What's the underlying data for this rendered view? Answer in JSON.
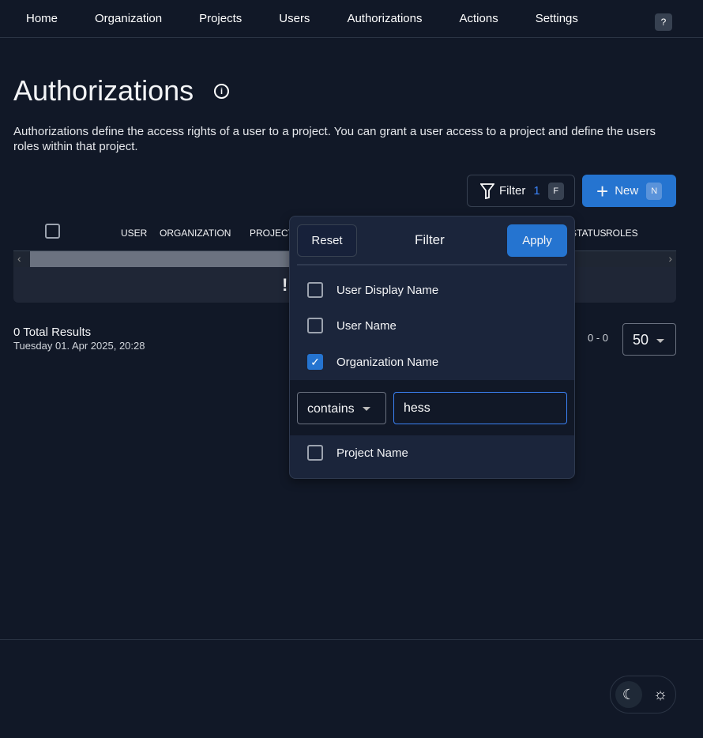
{
  "nav": {
    "items": [
      "Home",
      "Organization",
      "Projects",
      "Users",
      "Authorizations",
      "Actions",
      "Settings"
    ],
    "help": "?"
  },
  "page": {
    "title": "Authorizations",
    "description": "Authorizations define the access rights of a user to a project. You can grant a user access to a project and define the users roles within that project."
  },
  "toolbar": {
    "filter_label": "Filter",
    "filter_count": "1",
    "filter_key": "F",
    "new_label": "New",
    "new_key": "N"
  },
  "table": {
    "columns": [
      "USER",
      "ORGANIZATION",
      "PROJECT",
      "STATUS",
      "ROLES"
    ],
    "empty_icon": "!"
  },
  "footer": {
    "total": "0 Total Results",
    "date": "Tuesday 01. Apr 2025, 20:28",
    "range": "0 - 0",
    "page_size": "50"
  },
  "filter": {
    "reset": "Reset",
    "title": "Filter",
    "apply": "Apply",
    "options": [
      {
        "label": "User Display Name",
        "checked": false
      },
      {
        "label": "User Name",
        "checked": false
      },
      {
        "label": "Organization Name",
        "checked": true
      },
      {
        "label": "Project Name",
        "checked": false
      }
    ],
    "condition": "contains",
    "value": "hess"
  },
  "colors": {
    "accent": "#2574d0",
    "background": "#111827"
  }
}
